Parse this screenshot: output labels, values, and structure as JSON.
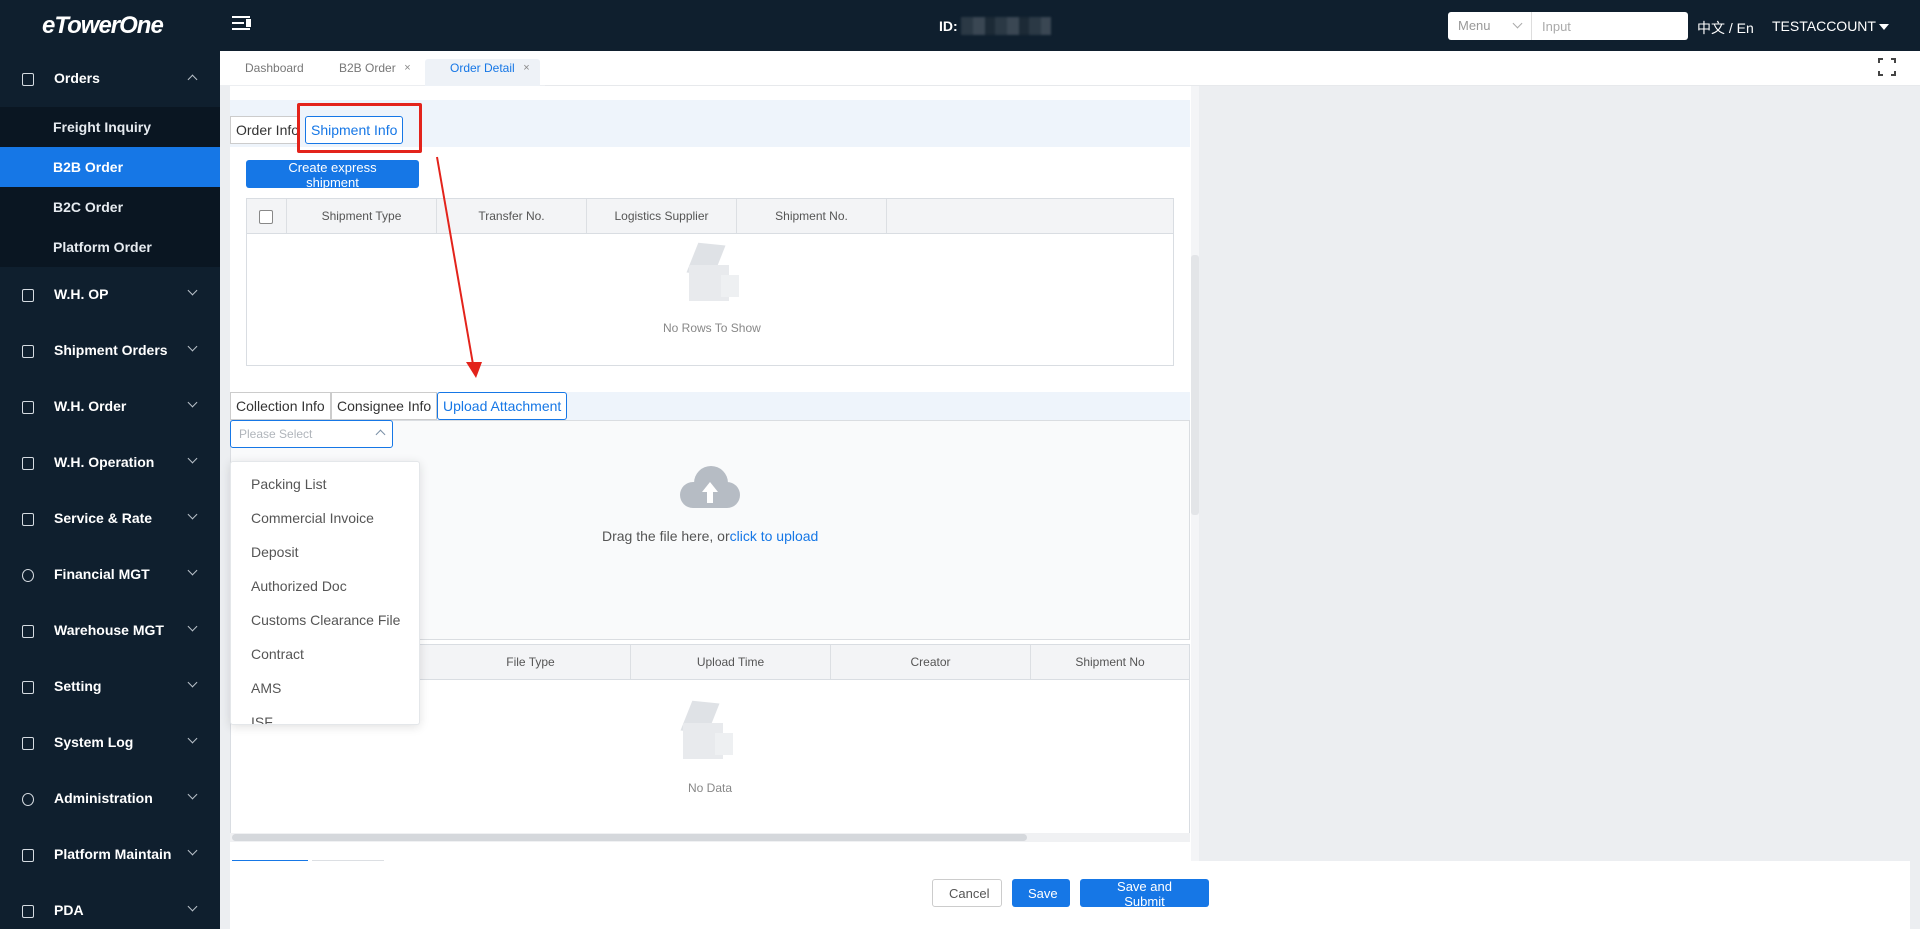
{
  "app": {
    "logo": "eTowerOne"
  },
  "header": {
    "id_label": "ID:",
    "menu_select": "Menu",
    "search_placeholder": "Input",
    "language": "中文 / En",
    "account": "TESTACCOUNT"
  },
  "sidebar": {
    "groups": [
      {
        "label": "Orders",
        "icon": "orders-icon",
        "open": true,
        "items": [
          {
            "label": "Freight Inquiry"
          },
          {
            "label": "B2B Order",
            "active": true
          },
          {
            "label": "B2C Order"
          },
          {
            "label": "Platform Order"
          }
        ]
      },
      {
        "label": "W.H. OP"
      },
      {
        "label": "Shipment Orders"
      },
      {
        "label": "W.H. Order"
      },
      {
        "label": "W.H. Operation"
      },
      {
        "label": "Service & Rate"
      },
      {
        "label": "Financial MGT"
      },
      {
        "label": "Warehouse MGT"
      },
      {
        "label": "Setting"
      },
      {
        "label": "System Log"
      },
      {
        "label": "Administration"
      },
      {
        "label": "Platform Maintain"
      },
      {
        "label": "PDA"
      }
    ]
  },
  "tabs": [
    {
      "label": "Dashboard"
    },
    {
      "label": "B2B Order",
      "close": "×"
    },
    {
      "label": "Order Detail",
      "close": "×",
      "active": true
    }
  ],
  "section1": {
    "tabs": [
      "Order Info",
      "Shipment Info"
    ],
    "create_button": "Create express shipment",
    "columns": [
      "Shipment Type",
      "Transfer No.",
      "Logistics Supplier",
      "Shipment No."
    ],
    "empty_text": "No Rows To Show"
  },
  "section2": {
    "tabs": [
      "Collection Info",
      "Consignee Info",
      "Upload Attachment"
    ],
    "select_placeholder": "Please Select",
    "upload_text": "Drag the file here, or",
    "upload_link": "click to upload",
    "columns": [
      "File Type",
      "Upload Time",
      "Creator",
      "Shipment No"
    ],
    "empty_text": "No Data"
  },
  "dropdown_options": [
    "Packing List",
    "Commercial Invoice",
    "Deposit",
    "Authorized Doc",
    "Customs Clearance File",
    "Contract",
    "AMS",
    "ISF"
  ],
  "footer": {
    "cancel": "Cancel",
    "save": "Save",
    "save_submit": "Save and Submit"
  },
  "colors": {
    "primary": "#1677e6",
    "sidebar_bg": "#0f1f2e",
    "annotation": "#e3231b"
  }
}
